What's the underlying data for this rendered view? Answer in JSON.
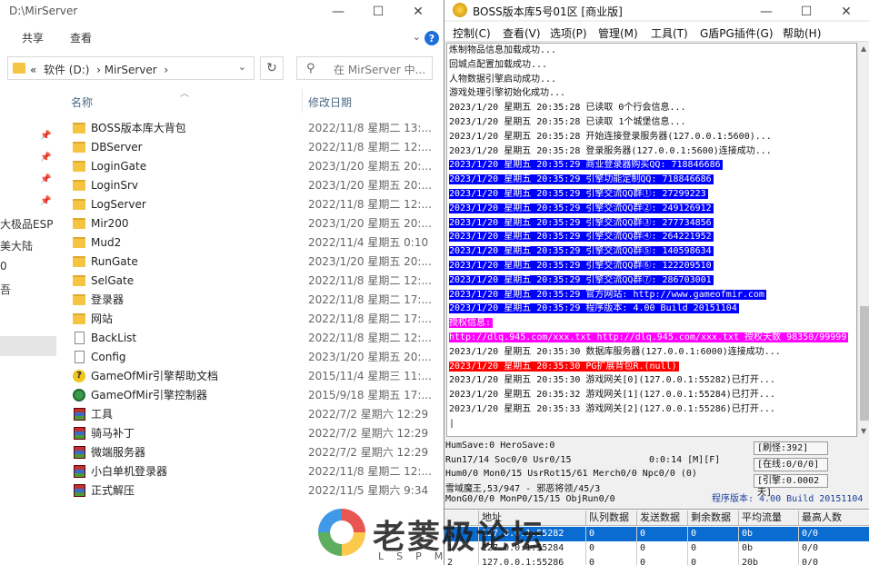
{
  "explorer": {
    "title": "D:\\MirServer",
    "ribbon": [
      "共享",
      "查看"
    ],
    "help": "?",
    "address": {
      "root": "«",
      "segments": [
        "软件 (D:)",
        "MirServer"
      ]
    },
    "search_placeholder": "在 MirServer 中...",
    "columns": {
      "name": "名称",
      "date": "修改日期"
    },
    "nav_items": [
      "大极品ESP",
      "美大陆",
      "0",
      "吾"
    ],
    "files": [
      {
        "name": "BOSS版本库大背包",
        "date": "2022/11/8 星期二 13:...",
        "type": "folder"
      },
      {
        "name": "DBServer",
        "date": "2022/11/8 星期二 12:...",
        "type": "folder"
      },
      {
        "name": "LoginGate",
        "date": "2023/1/20 星期五 20:...",
        "type": "folder"
      },
      {
        "name": "LoginSrv",
        "date": "2023/1/20 星期五 20:...",
        "type": "folder"
      },
      {
        "name": "LogServer",
        "date": "2022/11/8 星期二 12:...",
        "type": "folder"
      },
      {
        "name": "Mir200",
        "date": "2023/1/20 星期五 20:...",
        "type": "folder"
      },
      {
        "name": "Mud2",
        "date": "2022/11/4 星期五 0:10",
        "type": "folder"
      },
      {
        "name": "RunGate",
        "date": "2023/1/20 星期五 20:...",
        "type": "folder"
      },
      {
        "name": "SelGate",
        "date": "2022/11/8 星期二 12:...",
        "type": "folder"
      },
      {
        "name": "登录器",
        "date": "2022/11/8 星期二 17:...",
        "type": "folder"
      },
      {
        "name": "网站",
        "date": "2022/11/8 星期二 17:...",
        "type": "folder"
      },
      {
        "name": "BackList",
        "date": "2022/11/8 星期二 12:...",
        "type": "file"
      },
      {
        "name": "Config",
        "date": "2023/1/20 星期五 20:...",
        "type": "file"
      },
      {
        "name": "GameOfMir引擎帮助文档",
        "date": "2015/11/4 星期三 11:...",
        "type": "help"
      },
      {
        "name": "GameOfMir引擎控制器",
        "date": "2015/9/18 星期五 17:...",
        "type": "app"
      },
      {
        "name": "工具",
        "date": "2022/7/2 星期六 12:29",
        "type": "rar"
      },
      {
        "name": "骑马补丁",
        "date": "2022/7/2 星期六 12:29",
        "type": "rar"
      },
      {
        "name": "微端服务器",
        "date": "2022/7/2 星期六 12:29",
        "type": "rar"
      },
      {
        "name": "小白单机登录器",
        "date": "2022/11/8 星期二 12:...",
        "type": "rar"
      },
      {
        "name": "正式解压",
        "date": "2022/11/5 星期六 9:34",
        "type": "rar"
      }
    ]
  },
  "boss": {
    "title": "BOSS版本库5号01区 [商业版]",
    "menu": [
      "控制(C)",
      "查看(V)",
      "选项(P)",
      "管理(M)",
      "工具(T)",
      "G盾PG插件(G)",
      "帮助(H)"
    ],
    "log": [
      {
        "text": "炼制物品信息加载成功...",
        "style": "normal"
      },
      {
        "text": "回城点配置加载成功...",
        "style": "normal"
      },
      {
        "text": "人物数据引擎启动成功...",
        "style": "normal"
      },
      {
        "text": "游戏处理引擎初始化成功...",
        "style": "normal"
      },
      {
        "text": "2023/1/20 星期五 20:35:28 已读取 0个行会信息...",
        "style": "normal"
      },
      {
        "text": "2023/1/20 星期五 20:35:28 已读取 1个城堡信息...",
        "style": "normal"
      },
      {
        "text": "2023/1/20 星期五 20:35:28 开始连接登录服务器(127.0.0.1:5600)...",
        "style": "normal"
      },
      {
        "text": "2023/1/20 星期五 20:35:28 登录服务器(127.0.0.1:5600)连接成功...",
        "style": "normal"
      },
      {
        "text": "2023/1/20 星期五 20:35:29 商业登录器购买QQ: 718846686",
        "style": "blue"
      },
      {
        "text": "2023/1/20 星期五 20:35:29 引擎功能定制QQ: 718846686",
        "style": "blue"
      },
      {
        "text": "2023/1/20 星期五 20:35:29 引擎交流QQ群①: 27299223",
        "style": "blue"
      },
      {
        "text": "2023/1/20 星期五 20:35:29 引擎交流QQ群②: 249126912",
        "style": "blue"
      },
      {
        "text": "2023/1/20 星期五 20:35:29 引擎交流QQ群③: 277734856",
        "style": "blue"
      },
      {
        "text": "2023/1/20 星期五 20:35:29 引擎交流QQ群④: 264221952",
        "style": "blue"
      },
      {
        "text": "2023/1/20 星期五 20:35:29 引擎交流QQ群⑤: 140598634",
        "style": "blue"
      },
      {
        "text": "2023/1/20 星期五 20:35:29 引擎交流QQ群⑥: 122209510",
        "style": "blue"
      },
      {
        "text": "2023/1/20 星期五 20:35:29 引擎交流QQ群⑦: 286703001",
        "style": "blue"
      },
      {
        "text": "2023/1/20 星期五 20:35:29 官方网站: http://www.gameofmir.com",
        "style": "blue"
      },
      {
        "text": "2023/1/20 星期五 20:35:29 程序版本: 4.00 Build 20151104",
        "style": "blue"
      },
      {
        "text": "授权信息:",
        "style": "magenta"
      },
      {
        "text": "http://dlq.945.com/xxx.txt http://dlq.945.com/xxx.txt 授权天数 98350/99999",
        "style": "magenta"
      },
      {
        "text": "2023/1/20 星期五 20:35:30 数据库服务器(127.0.0.1:6000)连接成功...",
        "style": "normal"
      },
      {
        "text": "2023/1/20 星期五 20:35:30 PG扩展背包R.(null)",
        "style": "red"
      },
      {
        "text": "2023/1/20 星期五 20:35:30 游戏网关[0](127.0.0.1:55282)已打开...",
        "style": "normal"
      },
      {
        "text": "2023/1/20 星期五 20:35:32 游戏网关[1](127.0.0.1:55284)已打开...",
        "style": "normal"
      },
      {
        "text": "2023/1/20 星期五 20:35:33 游戏网关[2](127.0.0.1:55286)已打开...",
        "style": "normal"
      },
      {
        "text": "|",
        "style": "normal"
      }
    ],
    "status": {
      "line1": "HumSave:0 HeroSave:0",
      "line2": "Run17/14 Soc0/0 Usr0/15",
      "time": "0:0:14 [M][F]",
      "line3": "Hum0/0 Mon0/15 UsrRot15/61 Merch0/0 Npc0/0 (0)",
      "line4": "雪域魔王,53/947 - 邪恶将领/45/3",
      "line5": "MonG0/0/0 MonP0/15/15 ObjRun0/0",
      "refresh": "[刷怪:392]",
      "online": "[在线:0/0/0]",
      "engine": "[引擎:0.0002天]",
      "version": "程序版本: 4.00 Build 20151104"
    },
    "grid": {
      "headers": [
        "",
        "地址",
        "队列数据",
        "发送数据",
        "剩余数据",
        "平均流量",
        "最高人数"
      ],
      "rows": [
        {
          "cells": [
            "0",
            "127.0.0.1:55282",
            "0",
            "0",
            "0",
            "0b",
            "0/0"
          ],
          "selected": true
        },
        {
          "cells": [
            "1",
            "127.0.0.1:55284",
            "0",
            "0",
            "0",
            "0b",
            "0/0"
          ],
          "selected": false
        },
        {
          "cells": [
            "2",
            "127.0.0.1:55286",
            "0",
            "0",
            "0",
            "20b",
            "0/0"
          ],
          "selected": false
        }
      ]
    }
  },
  "watermark": {
    "text": "老菱极论坛",
    "sub": "LSPM"
  },
  "colors": {
    "log_blue": "#0000ff",
    "log_magenta": "#ff00ff",
    "log_red": "#ff0000",
    "grid_select": "#0a6cd0"
  }
}
